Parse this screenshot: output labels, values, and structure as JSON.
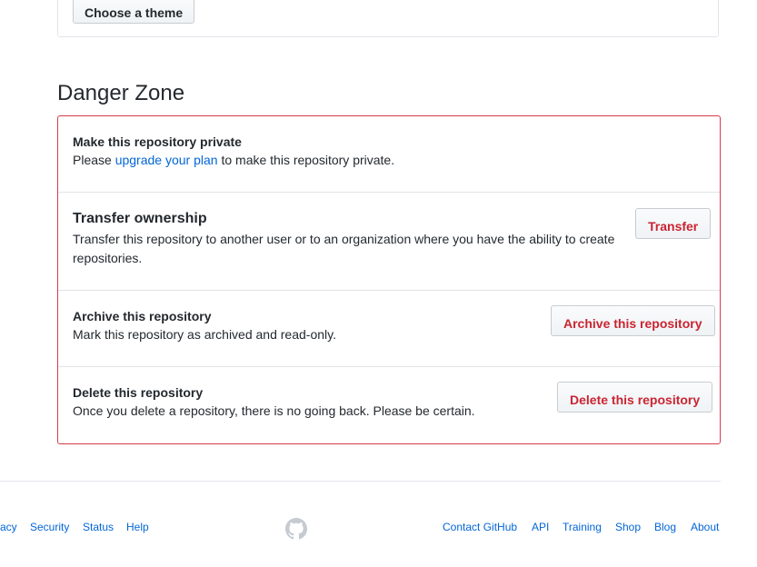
{
  "theme_section": {
    "choose_theme_label": "Choose a theme"
  },
  "danger_zone": {
    "title": "Danger Zone",
    "private": {
      "title": "Make this repository private",
      "desc_before": "Please ",
      "desc_link": "upgrade your plan",
      "desc_after": " to make this repository private."
    },
    "transfer": {
      "title": "Transfer ownership",
      "desc_line1": "Transfer this repository to another user or to an organization where you have the ability to create",
      "desc_line2": "repositories.",
      "button": "Transfer"
    },
    "archive": {
      "title": "Archive this repository",
      "desc": "Mark this repository as archived and read-only.",
      "button": "Archive this repository"
    },
    "delete": {
      "title": "Delete this repository",
      "desc": "Once you delete a repository, there is no going back. Please be certain.",
      "button": "Delete this repository"
    },
    "danger_color": "#cb2431",
    "border_color": "#d73a49"
  },
  "footer": {
    "left_links": [
      "acy",
      "Security",
      "Status",
      "Help"
    ],
    "right_links": [
      "Contact GitHub",
      "API",
      "Training",
      "Shop",
      "Blog",
      "About"
    ],
    "logo_icon": "github-mark-icon",
    "link_color": "#0366d6"
  }
}
